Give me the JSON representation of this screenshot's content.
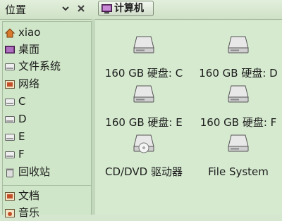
{
  "sidebar_header": {
    "title": "位置"
  },
  "path_bar": {
    "current": "计算机"
  },
  "sidebar": {
    "items": [
      {
        "label": "xiao",
        "icon": "home-icon"
      },
      {
        "label": "桌面",
        "icon": "desktop-icon"
      },
      {
        "label": "文件系统",
        "icon": "drive-icon"
      },
      {
        "label": "网络",
        "icon": "network-icon"
      },
      {
        "label": "C",
        "icon": "drive-icon"
      },
      {
        "label": "D",
        "icon": "drive-icon"
      },
      {
        "label": "E",
        "icon": "drive-icon"
      },
      {
        "label": "F",
        "icon": "drive-icon"
      },
      {
        "label": "回收站",
        "icon": "trash-icon"
      }
    ],
    "bookmarks": [
      {
        "label": "文档",
        "icon": "documents-icon"
      },
      {
        "label": "音乐",
        "icon": "music-icon"
      }
    ]
  },
  "main": {
    "items": [
      {
        "label": "160 GB 硬盘: C",
        "icon": "hard-disk-icon"
      },
      {
        "label": "160 GB 硬盘: D",
        "icon": "hard-disk-icon"
      },
      {
        "label": "160 GB 硬盘: E",
        "icon": "hard-disk-icon"
      },
      {
        "label": "160 GB 硬盘: F",
        "icon": "hard-disk-icon"
      },
      {
        "label": "CD/DVD 驱动器",
        "icon": "optical-drive-icon"
      },
      {
        "label": "File System",
        "icon": "hard-disk-icon"
      }
    ]
  }
}
